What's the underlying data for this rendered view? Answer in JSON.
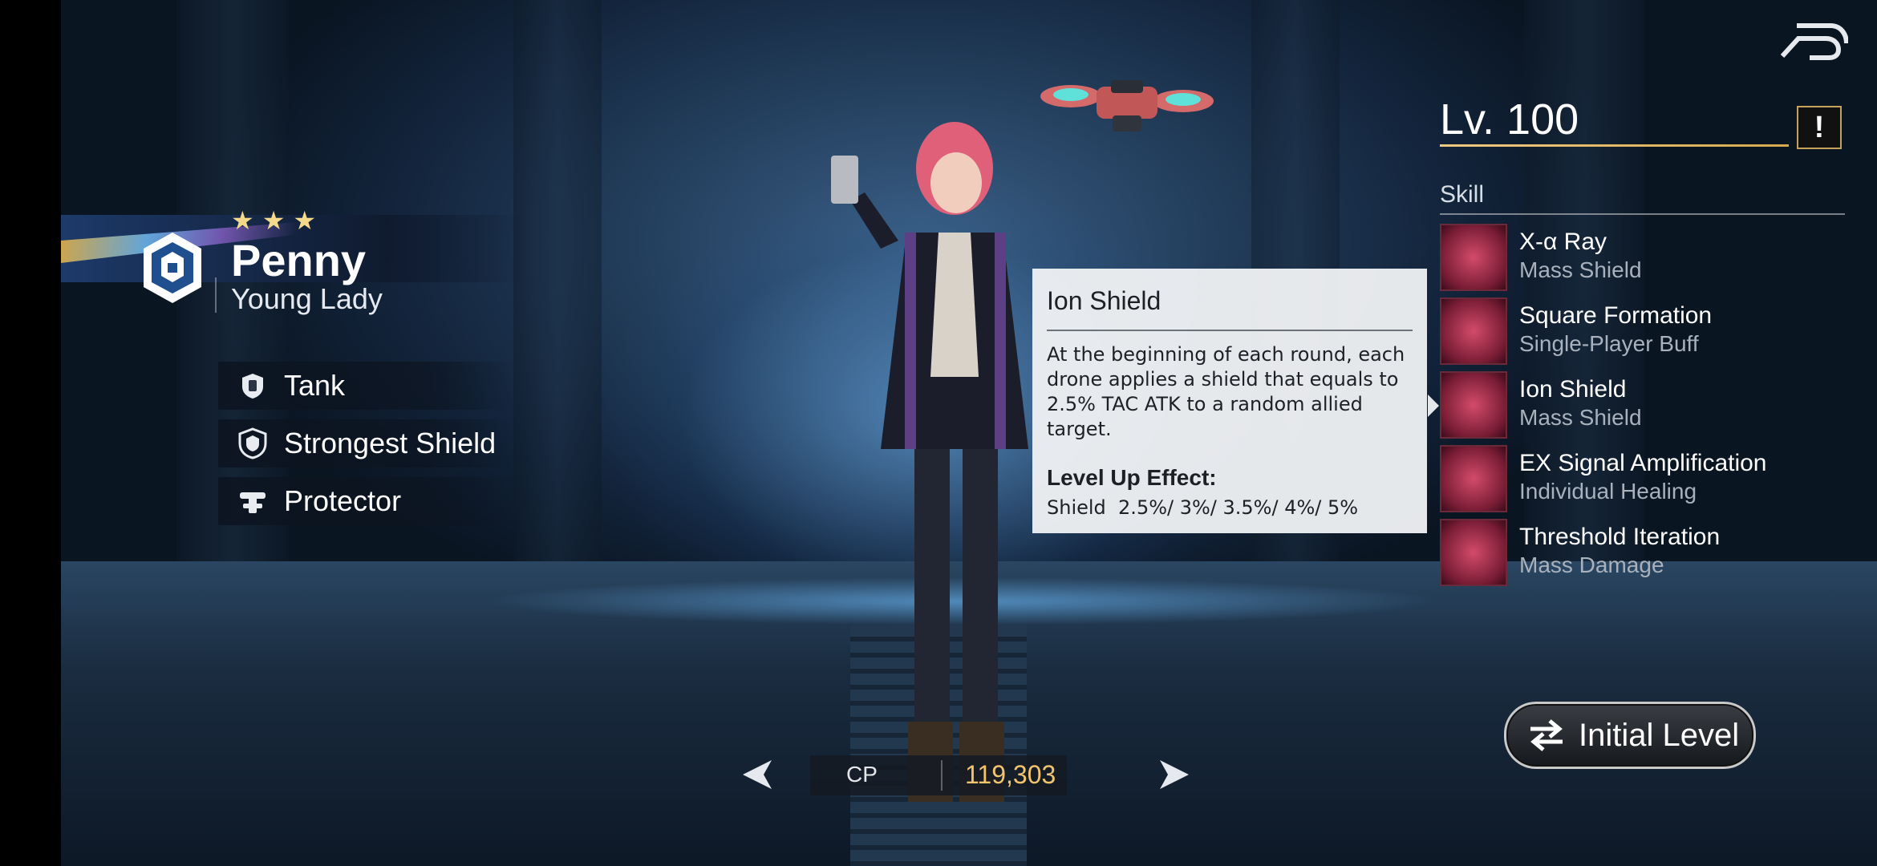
{
  "hero": {
    "stars": 3,
    "name": "Penny",
    "title": "Young Lady",
    "traits": [
      {
        "label": "Tank",
        "icon": "tank-shield-icon"
      },
      {
        "label": "Strongest Shield",
        "icon": "shield-badge-icon"
      },
      {
        "label": "Protector",
        "icon": "protector-icon"
      }
    ]
  },
  "level": {
    "text": "Lv. 100"
  },
  "info_button": {
    "label": "!"
  },
  "skills": {
    "header": "Skill",
    "items": [
      {
        "name": "X-α Ray",
        "type": "Mass Shield"
      },
      {
        "name": "Square Formation",
        "type": "Single-Player Buff"
      },
      {
        "name": "Ion Shield",
        "type": "Mass Shield"
      },
      {
        "name": "EX Signal Amplification",
        "type": "Individual Healing"
      },
      {
        "name": "Threshold Iteration",
        "type": "Mass Damage"
      }
    ]
  },
  "tooltip": {
    "title": "Ion Shield",
    "description": "At the beginning of each round, each drone applies a shield that equals to 2.5% TAC ATK to a random allied target.",
    "level_up_heading": "Level Up Effect:",
    "level_up_effect": "Shield  2.5%/ 3%/ 3.5%/ 4%/ 5%"
  },
  "cp": {
    "label": "CP",
    "value": "119,303"
  },
  "initial_level_button": {
    "label": "Initial Level"
  },
  "colors": {
    "accent_gold": "#f2c46e",
    "star_gold": "#f5d98a",
    "level_line": "#d6a94c",
    "tooltip_bg": "#eef0f2"
  }
}
